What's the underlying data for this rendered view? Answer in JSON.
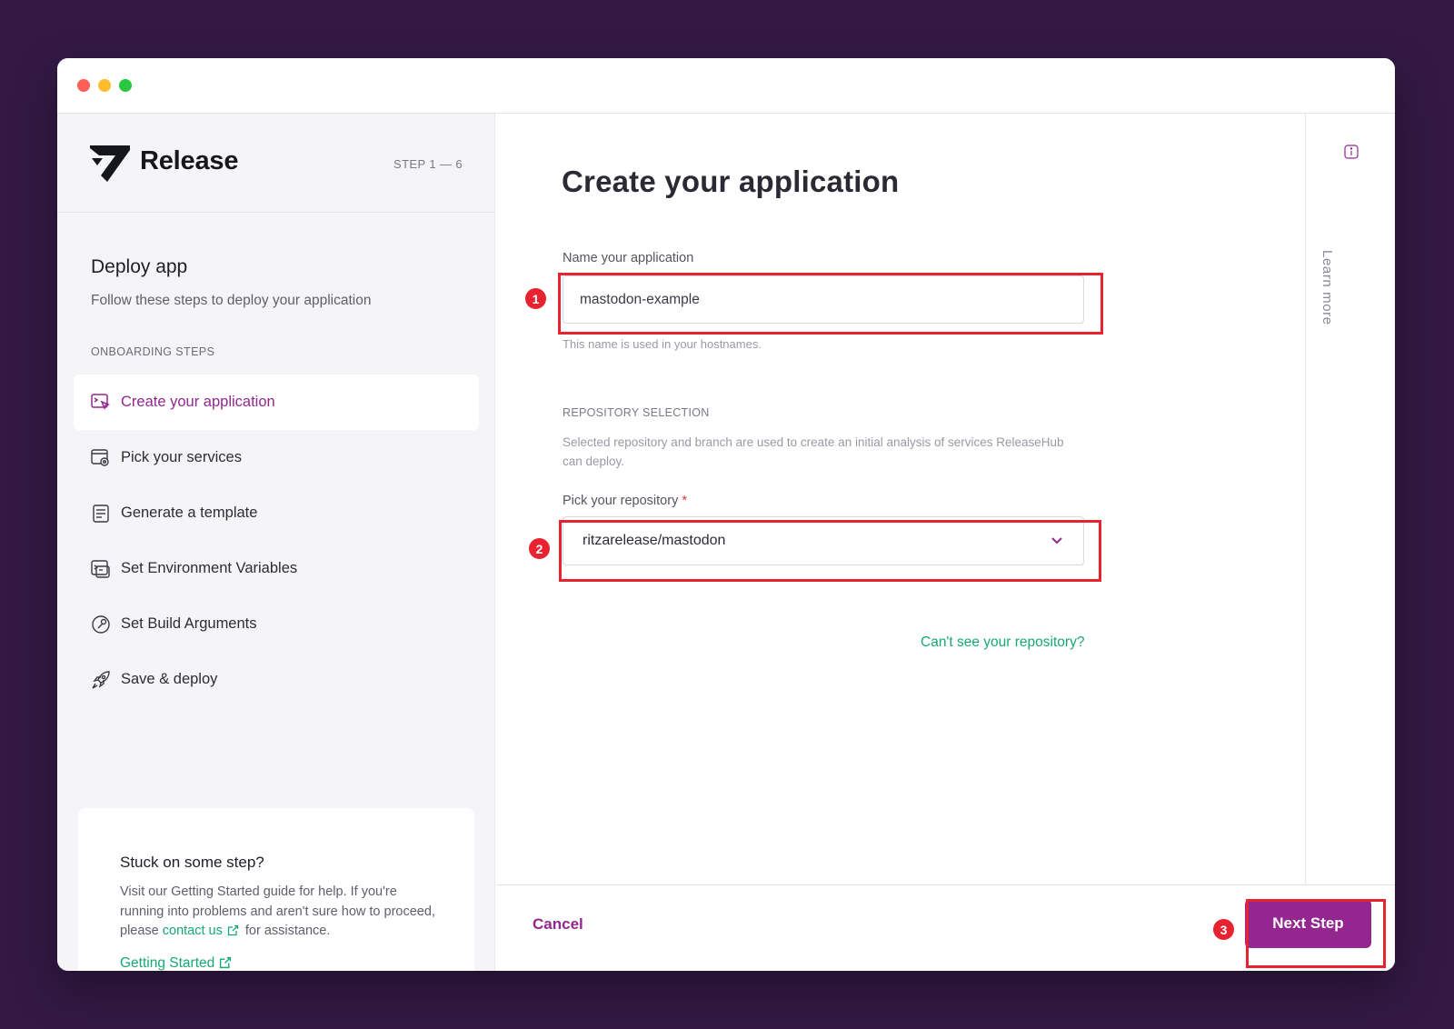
{
  "app": {
    "brand": "Release",
    "step_count": "STEP 1 — 6"
  },
  "sidebar": {
    "title": "Deploy app",
    "subtitle": "Follow these steps to deploy your application",
    "section_label": "ONBOARDING STEPS",
    "steps": [
      {
        "label": "Create your application",
        "icon": "app-cursor-icon",
        "active": true
      },
      {
        "label": "Pick your services",
        "icon": "services-window-icon"
      },
      {
        "label": "Generate a template",
        "icon": "template-doc-icon"
      },
      {
        "label": "Set Environment Variables",
        "icon": "terminal-icon"
      },
      {
        "label": "Set Build Arguments",
        "icon": "wrench-icon"
      },
      {
        "label": "Save & deploy",
        "icon": "rocket-icon"
      }
    ],
    "help": {
      "title": "Stuck on some step?",
      "body_before": "Visit our Getting Started guide for help. If you're running into problems and aren't sure how to proceed, please",
      "contact_link": "contact us",
      "body_after": "for assistance.",
      "getting_started_link": "Getting Started"
    }
  },
  "main": {
    "title": "Create your application",
    "name_label": "Name your application",
    "name_value": "mastodon-example",
    "name_hint": "This name is used in your hostnames.",
    "repo_section": "REPOSITORY SELECTION",
    "repo_desc": "Selected repository and branch are used to create an initial analysis of services ReleaseHub can deploy.",
    "repo_label": "Pick your repository",
    "repo_required": "*",
    "repo_value": "ritzarelease/mastodon",
    "repo_help_link": "Can't see your repository?"
  },
  "right_rail": {
    "learn_more": "Learn more"
  },
  "footer": {
    "cancel": "Cancel",
    "next": "Next Step"
  },
  "annotations": [
    "1",
    "2",
    "3"
  ],
  "colors": {
    "background": "#331944",
    "accent": "#93278f",
    "link": "#17a872",
    "annotation": "#e8222e"
  }
}
